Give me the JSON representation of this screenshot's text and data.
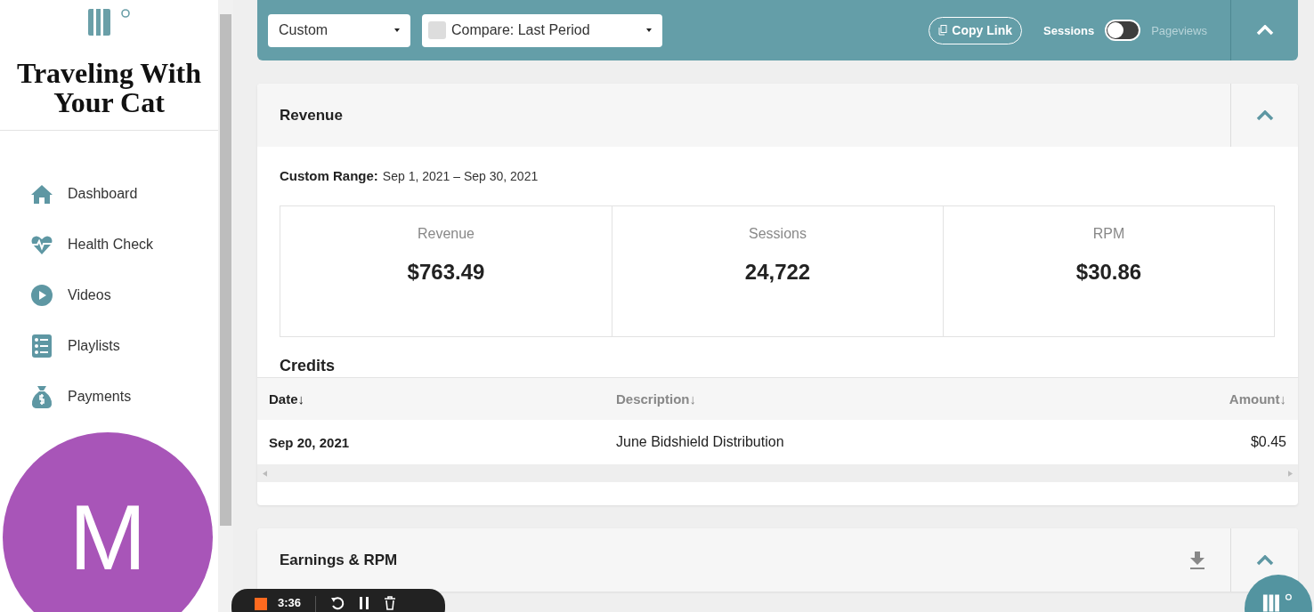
{
  "sidebar": {
    "site_title": "Traveling With Your Cat",
    "items": [
      {
        "label": "Dashboard",
        "kind": "home"
      },
      {
        "label": "Health Check",
        "kind": "heart"
      },
      {
        "label": "Videos",
        "kind": "play"
      },
      {
        "label": "Playlists",
        "kind": "list"
      },
      {
        "label": "Payments",
        "kind": "bag"
      }
    ],
    "avatar": {
      "initial": "M",
      "color": "#a855b8"
    }
  },
  "toolbar": {
    "range": "Custom",
    "compare": {
      "label": "Compare: Last Period",
      "checked": false
    },
    "copy_link": "Copy Link",
    "toggle": {
      "left": "Sessions",
      "right": "Pageviews",
      "on": false
    },
    "expanded": true
  },
  "revenue": {
    "title": "Revenue",
    "expanded": true,
    "range_label": "Custom Range:",
    "range": "Sep 1, 2021 – Sep 30, 2021",
    "stats": [
      {
        "label": "Revenue",
        "value": "$763.49"
      },
      {
        "label": "Sessions",
        "value": "24,722"
      },
      {
        "label": "RPM",
        "value": "$30.86"
      }
    ],
    "credits": {
      "title": "Credits",
      "columns": [
        "Date↓",
        "Description↓",
        "Amount↓"
      ],
      "rows": [
        {
          "date": "Sep 20, 2021",
          "description": "June Bidshield Distribution",
          "amount": "$0.45"
        }
      ]
    }
  },
  "earnings": {
    "title": "Earnings & RPM",
    "expanded": true
  },
  "recorder": {
    "time": "3:36"
  }
}
